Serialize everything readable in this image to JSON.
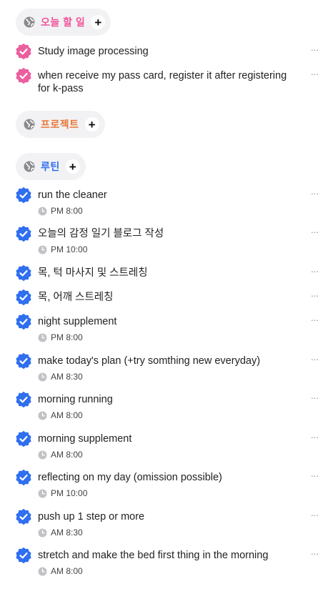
{
  "sections": {
    "today": {
      "title": "오늘 할 일",
      "color": "#f0529a"
    },
    "project": {
      "title": "프로젝트",
      "color": "#e8773a"
    },
    "routine": {
      "title": "루틴",
      "color": "#2f6ff0"
    }
  },
  "today_tasks": [
    {
      "title": "Study image processing"
    },
    {
      "title": "when receive my pass card, register it after registering for k-pass"
    }
  ],
  "routine_tasks": [
    {
      "title": "run the cleaner",
      "time": "PM 8:00"
    },
    {
      "title": "오늘의 감정 일기 블로그 작성",
      "time": "PM 10:00"
    },
    {
      "title": "목, 턱 마사지 및 스트레칭"
    },
    {
      "title": "목, 어깨 스트레칭"
    },
    {
      "title": "night supplement",
      "time": "PM 8:00"
    },
    {
      "title": "make today's plan (+try somthing new everyday)",
      "time": "AM 8:30"
    },
    {
      "title": "morning running",
      "time": "AM 8:00"
    },
    {
      "title": "morning supplement",
      "time": "AM 8:00"
    },
    {
      "title": "reflecting on my day (omission possible)",
      "time": "PM 10:00"
    },
    {
      "title": "push up 1 step or more",
      "time": "AM 8:30"
    },
    {
      "title": "stretch and make the bed first thing in the morning",
      "time": "AM 8:00"
    }
  ],
  "icons": {
    "section_icon": "globe-icon",
    "add_icon": "plus-icon",
    "check_icon": "check-badge-icon",
    "time_icon": "clock-icon",
    "more_icon": "more-dots-icon"
  },
  "more_label": "···",
  "add_label": "+"
}
